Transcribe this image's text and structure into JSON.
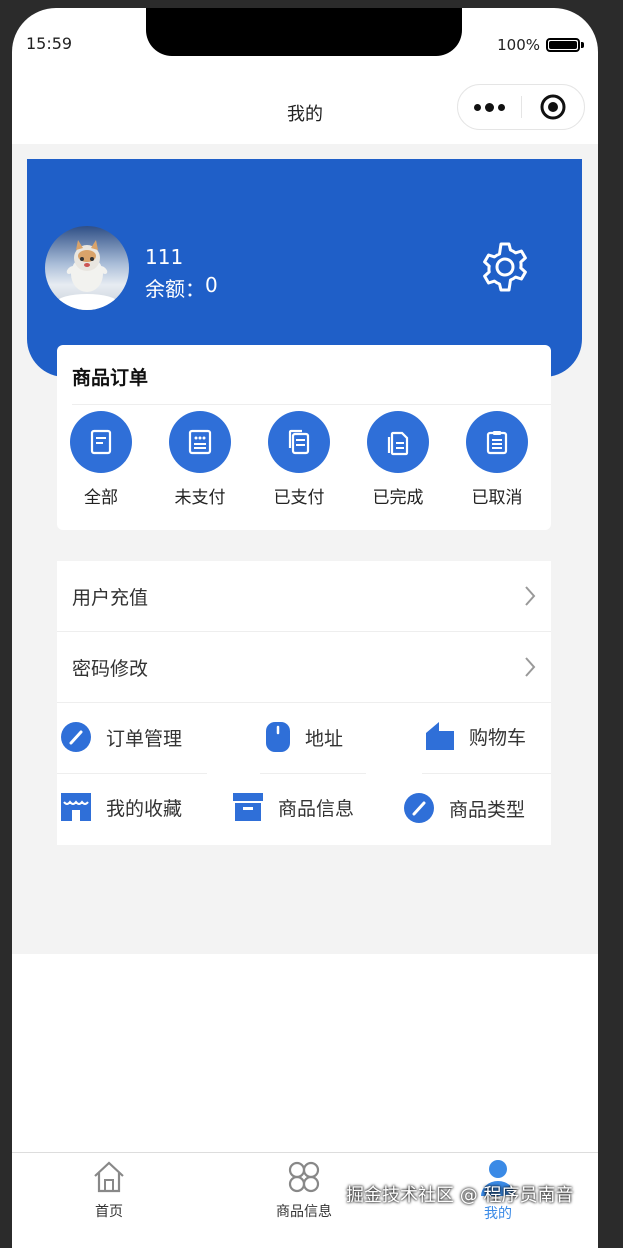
{
  "status": {
    "time": "15:59",
    "battery": "100%"
  },
  "navbar": {
    "title": "我的"
  },
  "profile": {
    "name": "111",
    "balance_label": "余额：",
    "balance_value": "0"
  },
  "orders": {
    "title": "商品订单",
    "items": [
      {
        "label": "全部",
        "icon": "doc-icon"
      },
      {
        "label": "未支付",
        "icon": "pending-icon"
      },
      {
        "label": "已支付",
        "icon": "copy-icon"
      },
      {
        "label": "已完成",
        "icon": "files-icon"
      },
      {
        "label": "已取消",
        "icon": "clipboard-icon"
      }
    ]
  },
  "menu": {
    "rows": [
      {
        "label": "用户充值"
      },
      {
        "label": "密码修改"
      }
    ],
    "grid": [
      {
        "label": "订单管理",
        "icon": "gauge-icon"
      },
      {
        "label": "地址",
        "icon": "mouse-icon"
      },
      {
        "label": "购物车",
        "icon": "building-icon"
      },
      {
        "label": "我的收藏",
        "icon": "store-icon"
      },
      {
        "label": "商品信息",
        "icon": "archive-icon"
      },
      {
        "label": "商品类型",
        "icon": "gauge-icon"
      }
    ]
  },
  "tabbar": {
    "items": [
      {
        "label": "首页",
        "icon": "home-icon"
      },
      {
        "label": "商品信息",
        "icon": "grid-icon"
      },
      {
        "label": "我的",
        "icon": "user-icon"
      }
    ]
  },
  "watermark": "掘金技术社区 @ 程序员南音",
  "colors": {
    "header": "#1f5fc8",
    "accent": "#2f6fd8",
    "tab_active": "#3a8ae6"
  }
}
